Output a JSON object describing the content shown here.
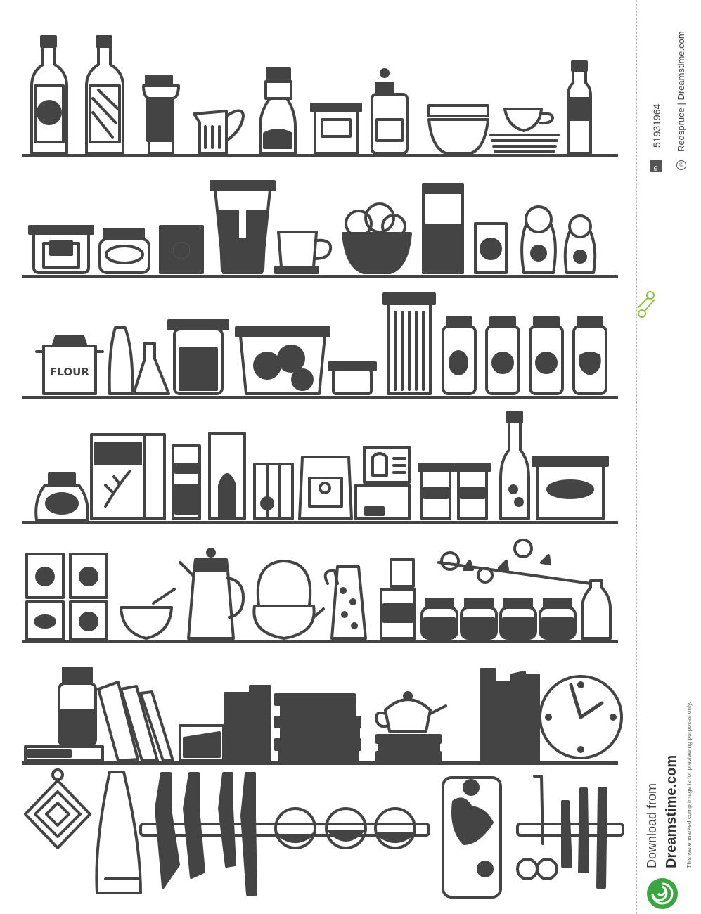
{
  "illustration": {
    "flour_label": "FLOUR"
  },
  "sidebar": {
    "id_badge": "ID",
    "image_id": "51931964",
    "copyright_symbol": "©",
    "credit": "Redspruce | Dreamstime.com",
    "download_from": "Download from",
    "site_name": "Dreamstime.com",
    "disclaimer": "This watermarked comp image is for previewing purposes only."
  },
  "colors": {
    "ink": "#444444",
    "accent_green": "#8cc63f",
    "logo_green": "#3aa63f"
  }
}
